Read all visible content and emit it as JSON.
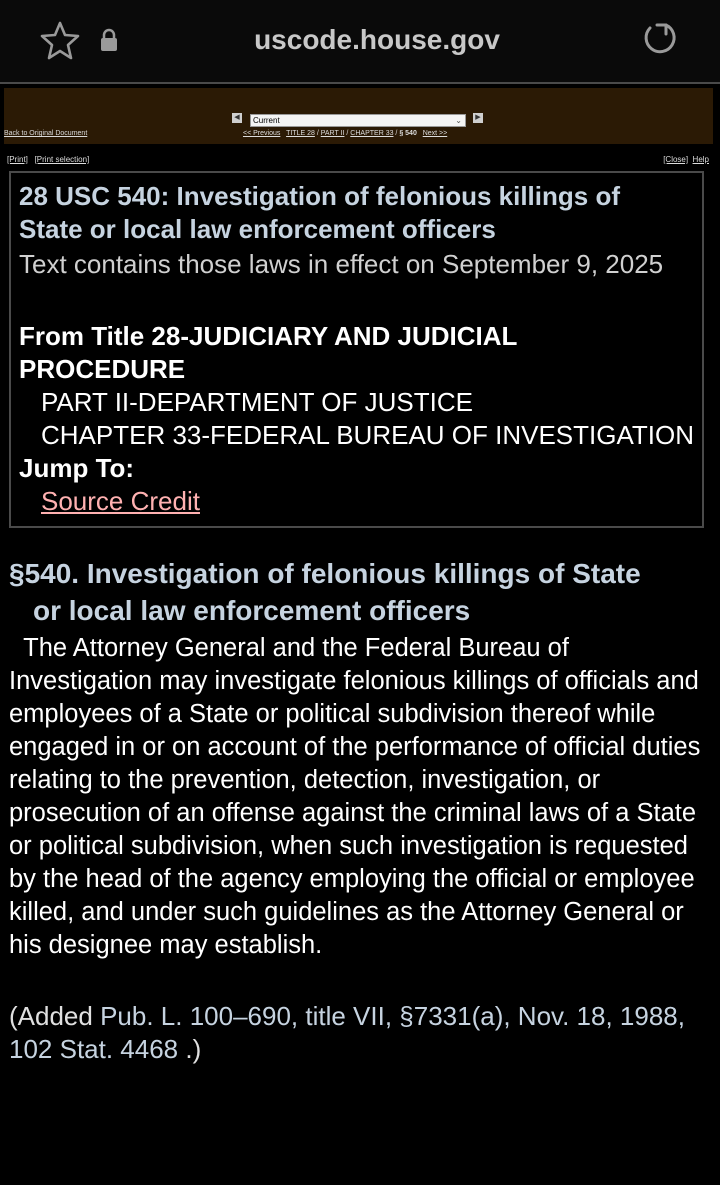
{
  "browser": {
    "url": "uscode.house.gov",
    "star_icon": "star-outline-icon",
    "lock_icon": "lock-icon",
    "reload_icon": "reload-icon"
  },
  "nav": {
    "back_to_original": "Back to Original Document",
    "select_value": "Current",
    "previous": "<< Previous",
    "title": "TITLE 28",
    "part": "PART II",
    "chapter": "CHAPTER 33",
    "current_section": "§ 540",
    "next": "Next >>",
    "print": "[Print]",
    "print_selection": "[Print selection]",
    "close": "[Close]",
    "help": "Help"
  },
  "box": {
    "title": "28 USC 540: Investigation of felonious killings of State or local law enforcement officers",
    "subtitle": "Text contains those laws in effect on September 9, 2025",
    "from_title": "From Title 28-JUDICIARY AND JUDICIAL PROCEDURE",
    "part": "PART II-DEPARTMENT OF JUSTICE",
    "chapter": "CHAPTER 33-FEDERAL BUREAU OF INVESTIGATION",
    "jump_to": "Jump To:",
    "source_credit": "Source Credit"
  },
  "section": {
    "heading_line1": "§540. Investigation of felonious killings of State",
    "heading_line2": "or local law enforcement officers",
    "body": "The Attorney General and the Federal Bureau of Investigation may investigate felonious killings of officials and employees of a State or political subdivision thereof while engaged in or on account of the performance of official duties relating to the prevention, detection, investigation, or prosecution of an offense against the criminal laws of a State or political subdivision, when such investigation is requested by the head of the agency employing the official or employee killed, and under such guidelines as the Attorney General or his designee may establish.",
    "added_prefix": "(Added ",
    "added_ref": "Pub. L. 100–690, title VII, §7331(a), Nov. 18, 1988, 102 Stat. 4468",
    "added_suffix": " .)"
  },
  "colors": {
    "background": "#000000",
    "heading_blue": "#c6d3e0",
    "link_pink": "#ffb1b1",
    "nav_strip": "#2b1a05"
  }
}
